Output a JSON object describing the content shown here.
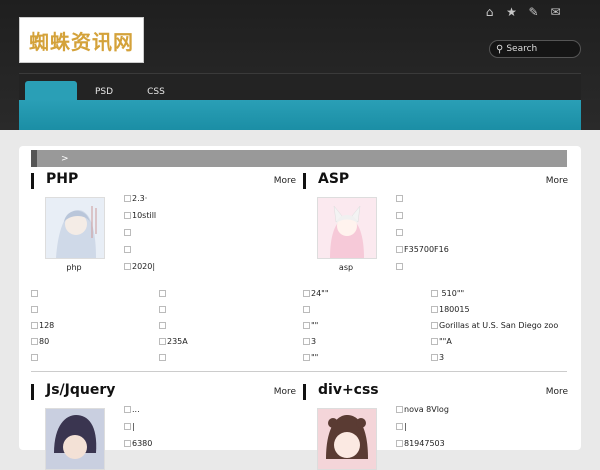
{
  "site": {
    "logo_text": "蜘蛛资讯网"
  },
  "top_icons": [
    "home-icon",
    "star-icon",
    "edit-icon",
    "chat-icon"
  ],
  "search": {
    "placeholder": "Search"
  },
  "nav": {
    "tabs": [
      {
        "label": ""
      },
      {
        "label": "PSD"
      },
      {
        "label": "CSS"
      }
    ]
  },
  "breadcrumb": {
    "text": ">"
  },
  "sections": [
    {
      "title": "PHP",
      "more": "More",
      "thumb_label": "php",
      "right_items": [
        "2.3·",
        "10still",
        "",
        "",
        "2020|"
      ],
      "grid": [
        [
          "",
          ""
        ],
        [
          "",
          ""
        ],
        [
          "128",
          ""
        ],
        [
          "80",
          "235A"
        ],
        [
          "",
          ""
        ]
      ]
    },
    {
      "title": "ASP",
      "more": "More",
      "thumb_label": "asp",
      "right_items": [
        "",
        "",
        "",
        "F35700F16",
        ""
      ],
      "grid": [
        [
          "24\"\"",
          " 510\"\""
        ],
        [
          "",
          "180015"
        ],
        [
          "\"\"",
          "Gorillas at U.S. San Diego zoo"
        ],
        [
          "3",
          "\"\"A"
        ],
        [
          "\"\"",
          "3"
        ]
      ]
    },
    {
      "title": "Js/Jquery",
      "more": "More",
      "thumb_label": "",
      "right_items": [
        "...",
        "|",
        "6380"
      ]
    },
    {
      "title": "div+css",
      "more": "More",
      "thumb_label": "",
      "right_items": [
        "nova 8Vlog",
        "|",
        "81947503"
      ]
    }
  ]
}
